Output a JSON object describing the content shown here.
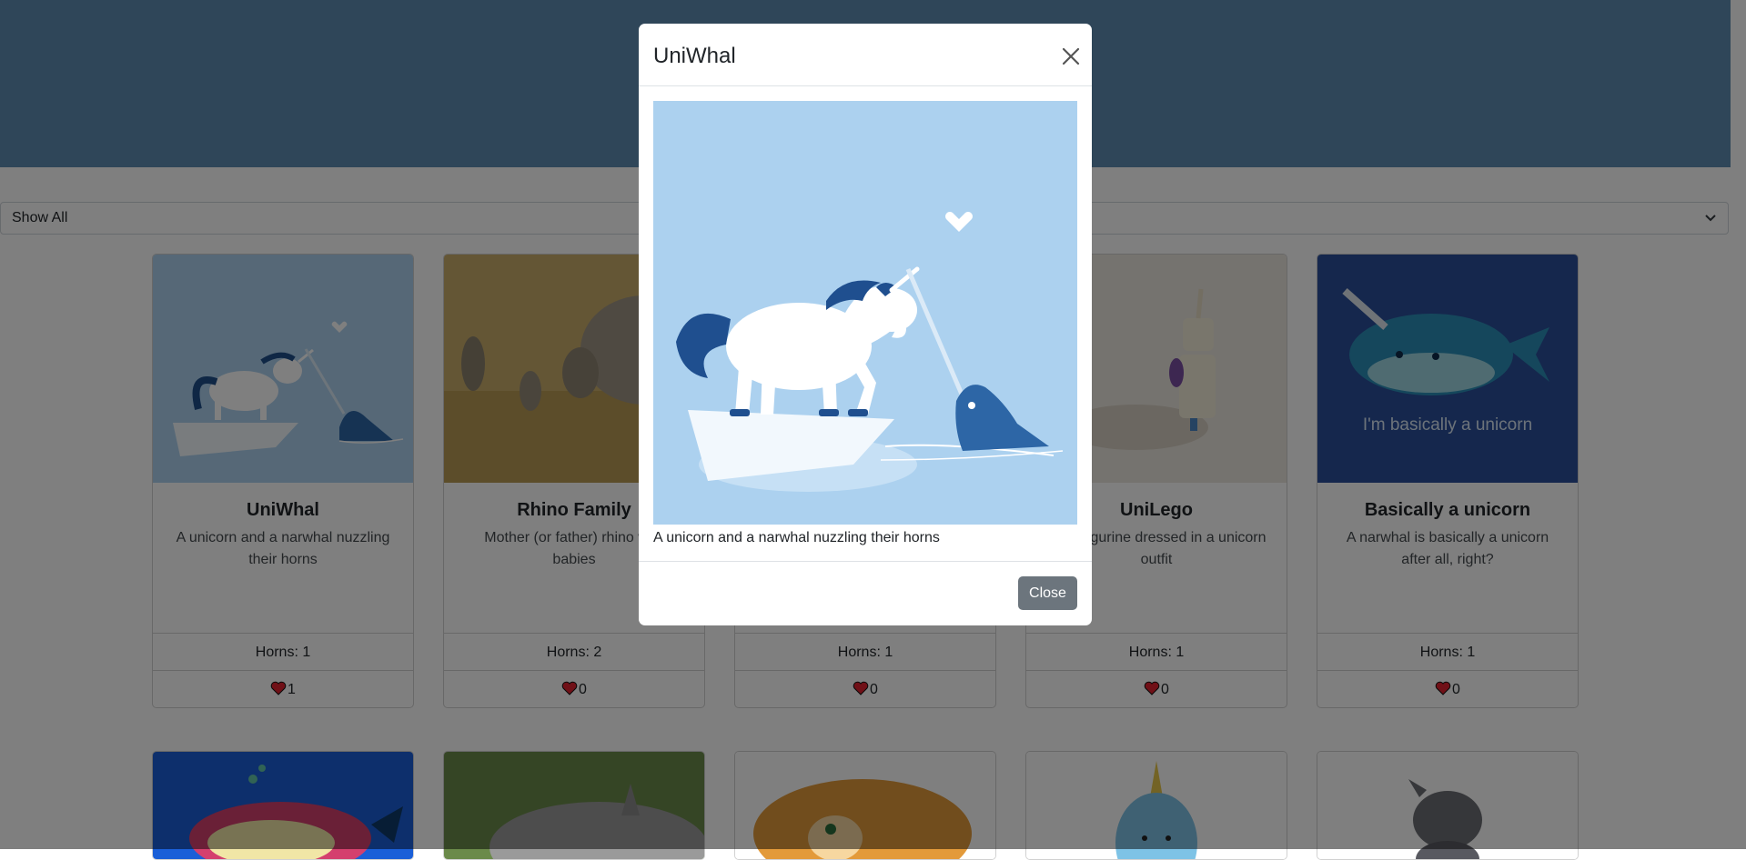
{
  "filter": {
    "selected": "Show All"
  },
  "cards": [
    {
      "title": "UniWhal",
      "description": "A unicorn and a narwhal nuzzling their horns",
      "horns_label": "Horns: 1",
      "likes": "1"
    },
    {
      "title": "Rhino Family",
      "description": "Mother (or father) rhino with babies",
      "horns_label": "Horns: 2",
      "likes": "0"
    },
    {
      "title": "",
      "description": "",
      "horns_label": "Horns: 1",
      "likes": "0"
    },
    {
      "title": "UniLego",
      "description": "Lego figurine dressed in a unicorn outfit",
      "horns_label": "Horns: 1",
      "likes": "0"
    },
    {
      "title": "Basically a unicorn",
      "description": "A narwhal is basically a unicorn after all, right?",
      "horns_label": "Horns: 1",
      "likes": "0"
    }
  ],
  "card_images": {
    "basically_unicorn_text": "I'm basically a unicorn"
  },
  "modal": {
    "title": "UniWhal",
    "caption": "A unicorn and a narwhal nuzzling their horns",
    "close_button": "Close"
  },
  "colors": {
    "header": "#5f8db3",
    "overlay": "rgba(0,0,0,0.5)",
    "close_button": "#6c757d",
    "heart": "#e0202e"
  }
}
